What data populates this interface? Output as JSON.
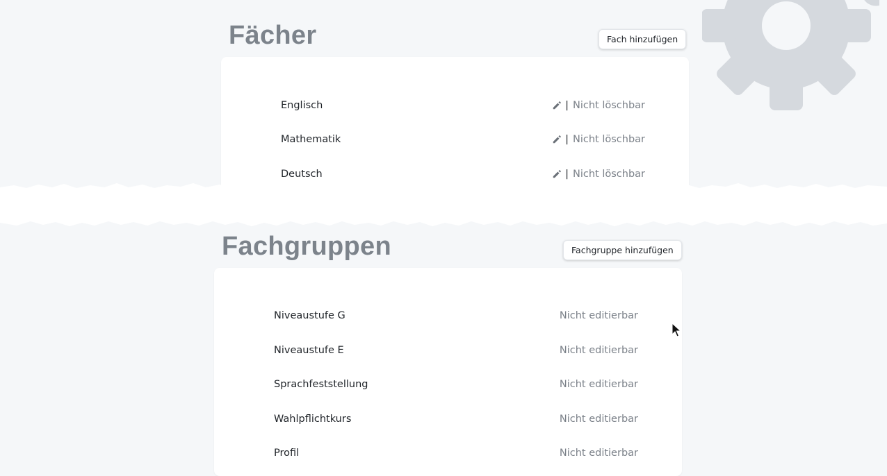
{
  "faecher": {
    "title": "Fächer",
    "add_button": "Fach hinzufügen",
    "items": [
      {
        "name": "Englisch",
        "separator": "|",
        "status": "Nicht löschbar",
        "icon": "pencil-icon"
      },
      {
        "name": "Mathematik",
        "separator": "|",
        "status": "Nicht löschbar",
        "icon": "pencil-icon"
      },
      {
        "name": "Deutsch",
        "separator": "|",
        "status": "Nicht löschbar",
        "icon": "pencil-icon"
      }
    ]
  },
  "fachgruppen": {
    "title": "Fachgruppen",
    "add_button": "Fachgruppe hinzufügen",
    "items": [
      {
        "name": "Niveaustufe G",
        "status": "Nicht editierbar"
      },
      {
        "name": "Niveaustufe E",
        "status": "Nicht editierbar"
      },
      {
        "name": "Sprachfeststellung",
        "status": "Nicht editierbar"
      },
      {
        "name": "Wahlpflichtkurs",
        "status": "Nicht editierbar"
      },
      {
        "name": "Profil",
        "status": "Nicht editierbar"
      }
    ]
  },
  "decor": {
    "gear_icon": "gear-icon",
    "gear_color": "#d5d9de",
    "background_color": "#f5f7f9"
  }
}
